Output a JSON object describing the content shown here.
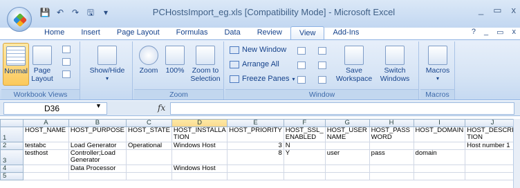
{
  "window": {
    "title": "PCHostsImport_eg.xls  [Compatibility Mode]  -  Microsoft Excel",
    "controls": [
      "_",
      "▭",
      "x"
    ]
  },
  "qat": [
    "💾",
    "↶",
    "↷",
    "🖫",
    "▾"
  ],
  "tabs": [
    "Home",
    "Insert",
    "Page Layout",
    "Formulas",
    "Data",
    "Review",
    "View",
    "Add-Ins"
  ],
  "tab_right": [
    "?",
    "_",
    "▭",
    "x"
  ],
  "ribbon": {
    "groups": {
      "workbook_views": "Workbook Views",
      "zoom": "Zoom",
      "window": "Window",
      "macros": "Macros"
    },
    "buttons": {
      "normal": "Normal",
      "page_layout": "Page Layout",
      "show_hide": "Show/Hide",
      "zoom": "Zoom",
      "zoom100": "100%",
      "zoom_to_selection": "Zoom to Selection",
      "new_window": "New Window",
      "arrange_all": "Arrange All",
      "freeze_panes": "Freeze Panes",
      "save_workspace": "Save Workspace",
      "switch_windows": "Switch Windows",
      "macros": "Macros"
    }
  },
  "formula_bar": {
    "namebox": "D36",
    "fx": "fx",
    "value": ""
  },
  "sheet": {
    "columns": [
      "A",
      "B",
      "C",
      "D",
      "E",
      "F",
      "G",
      "H",
      "I",
      "J"
    ],
    "rows": [
      {
        "n": "1",
        "cells": [
          "HOST_NAME",
          "HOST_PURPOSE",
          "HOST_STATE",
          "HOST_INSTALLA TION",
          "HOST_PRIORITY",
          "HOST_SSL_ ENABLED",
          "HOST_USER NAME",
          "HOST_PASS WORD",
          "HOST_DOMAIN",
          "HOST_DESCRIP TION"
        ]
      },
      {
        "n": "2",
        "cells": [
          "testabc",
          "Load Generator",
          "Operational",
          "Windows Host",
          "3",
          "N",
          "",
          "",
          "",
          "Host number 1"
        ]
      },
      {
        "n": "3",
        "cells": [
          "testhost",
          "Controller;Load Generator",
          "",
          "",
          "8",
          "Y",
          "user",
          "pass",
          "domain",
          ""
        ]
      },
      {
        "n": "4",
        "cells": [
          "",
          "Data Processor",
          "",
          "Windows Host",
          "",
          "",
          "",
          "",
          "",
          ""
        ]
      },
      {
        "n": "5",
        "cells": [
          "",
          "",
          "",
          "",
          "",
          "",
          "",
          "",
          "",
          ""
        ]
      }
    ]
  }
}
